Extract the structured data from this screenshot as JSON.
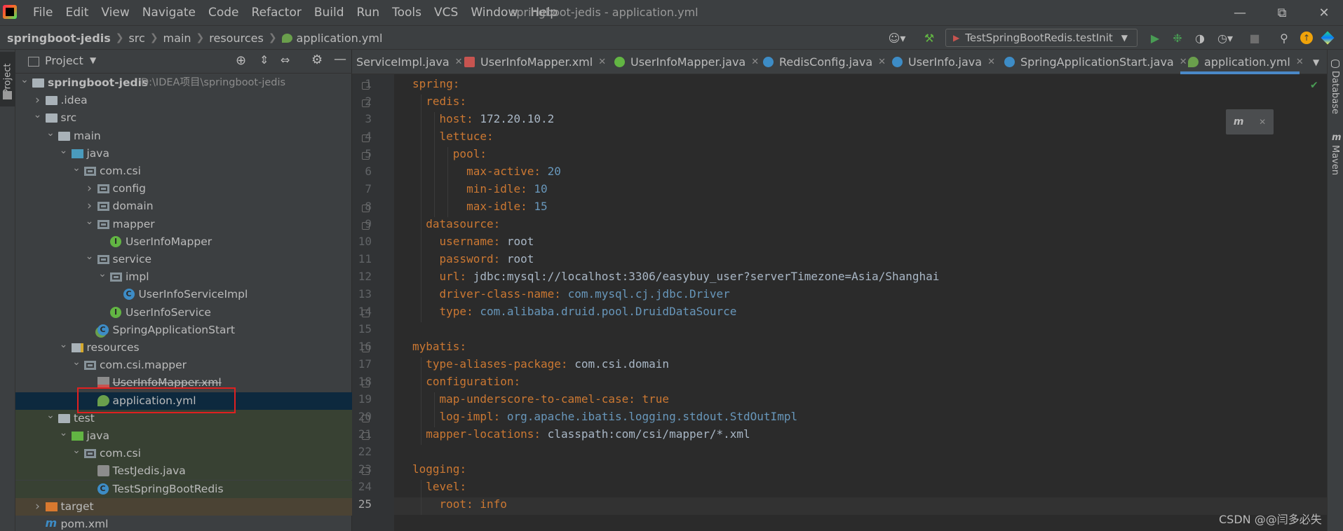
{
  "window": {
    "title": "springboot-jedis - application.yml",
    "menu": [
      "File",
      "Edit",
      "View",
      "Navigate",
      "Code",
      "Refactor",
      "Build",
      "Run",
      "Tools",
      "VCS",
      "Window",
      "Help"
    ]
  },
  "breadcrumbs": [
    "springboot-jedis",
    "src",
    "main",
    "resources",
    "application.yml"
  ],
  "run_config": "TestSpringBootRedis.testInit",
  "project_panel": {
    "title": "Project",
    "tree": [
      {
        "label": "springboot-jedis",
        "path": "D:\\IDEA项目\\springboot-jedis"
      },
      {
        "label": ".idea"
      },
      {
        "label": "src"
      },
      {
        "label": "main"
      },
      {
        "label": "java"
      },
      {
        "label": "com.csi"
      },
      {
        "label": "config"
      },
      {
        "label": "domain"
      },
      {
        "label": "mapper"
      },
      {
        "label": "UserInfoMapper"
      },
      {
        "label": "service"
      },
      {
        "label": "impl"
      },
      {
        "label": "UserInfoServiceImpl"
      },
      {
        "label": "UserInfoService"
      },
      {
        "label": "SpringApplicationStart"
      },
      {
        "label": "resources"
      },
      {
        "label": "com.csi.mapper"
      },
      {
        "label": "UserInfoMapper.xml"
      },
      {
        "label": "application.yml"
      },
      {
        "label": "test"
      },
      {
        "label": "java"
      },
      {
        "label": "com.csi"
      },
      {
        "label": "TestJedis.java"
      },
      {
        "label": "TestSpringBootRedis"
      },
      {
        "label": "target"
      },
      {
        "label": "pom.xml"
      }
    ]
  },
  "tabs": [
    {
      "label": "ServiceImpl.java"
    },
    {
      "label": "UserInfoMapper.xml"
    },
    {
      "label": "UserInfoMapper.java"
    },
    {
      "label": "RedisConfig.java"
    },
    {
      "label": "UserInfo.java"
    },
    {
      "label": "SpringApplicationStart.java"
    },
    {
      "label": "application.yml"
    }
  ],
  "code": {
    "line_numbers": [
      "1",
      "2",
      "3",
      "4",
      "5",
      "6",
      "7",
      "8",
      "9",
      "10",
      "11",
      "12",
      "13",
      "14",
      "15",
      "16",
      "17",
      "18",
      "19",
      "20",
      "21",
      "22",
      "23",
      "24",
      "25"
    ],
    "l1_key": "spring",
    "l2_key": "redis",
    "l3_key": "host",
    "l3_val": "172.20.10.2",
    "l4_key": "lettuce",
    "l5_key": "pool",
    "l6_key": "max-active",
    "l6_val": "20",
    "l7_key": "min-idle",
    "l7_val": "10",
    "l8_key": "max-idle",
    "l8_val": "15",
    "l9_key": "datasource",
    "l10_key": "username",
    "l10_val": "root",
    "l11_key": "password",
    "l11_val": "root",
    "l12_key": "url",
    "l12_val": "jdbc:mysql://localhost:3306/easybuy_user?serverTimezone=Asia/Shanghai",
    "l13_key": "driver-class-name",
    "l13_val": "com.mysql.cj.jdbc.Driver",
    "l14_key": "type",
    "l14_val": "com.alibaba.druid.pool.DruidDataSource",
    "l16_key": "mybatis",
    "l17_key": "type-aliases-package",
    "l17_val": "com.csi.domain",
    "l18_key": "configuration",
    "l19_key": "map-underscore-to-camel-case",
    "l19_val": "true",
    "l20_key": "log-impl",
    "l20_val": "org.apache.ibatis.logging.stdout.StdOutImpl",
    "l21_key": "mapper-locations",
    "l21_val": "classpath:com/csi/mapper/*.xml",
    "l23_key": "logging",
    "l24_key": "level",
    "l25_key": "root",
    "l25_val": "info"
  },
  "right_tools": [
    "Database",
    "Maven"
  ],
  "watermark": "CSDN @@闫多必失"
}
